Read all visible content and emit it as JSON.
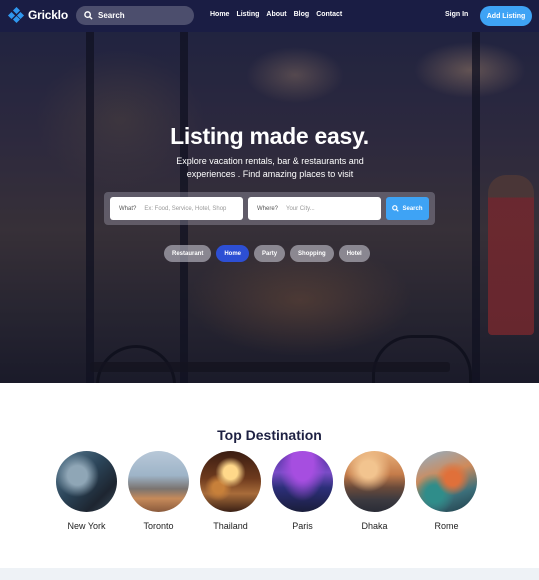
{
  "header": {
    "logo_text": "Gricklo",
    "search_label": "Search",
    "nav": [
      "Home",
      "Listing",
      "About",
      "Blog",
      "Contact"
    ],
    "sign_in": "Sign In",
    "add_listing": "Add Listing"
  },
  "hero": {
    "title": "Listing made easy.",
    "subtitle": "Explore vacation rentals, bar & restaurants and experiences . Find amazing places to visit",
    "search": {
      "what_label": "What?",
      "what_placeholder": "Ex: Food, Service, Hotel, Shop",
      "where_label": "Where?",
      "where_placeholder": "Your City...",
      "button": "Search"
    },
    "chips": [
      {
        "label": "Restaurant",
        "active": false
      },
      {
        "label": "Home",
        "active": true
      },
      {
        "label": "Party",
        "active": false
      },
      {
        "label": "Shopping",
        "active": false
      },
      {
        "label": "Hotel",
        "active": false
      }
    ]
  },
  "destinations": {
    "title": "Top Destination",
    "items": [
      {
        "name": "New York",
        "image": "new-york-photo"
      },
      {
        "name": "Toronto",
        "image": "toronto-photo"
      },
      {
        "name": "Thailand",
        "image": "thailand-photo"
      },
      {
        "name": "Paris",
        "image": "paris-photo"
      },
      {
        "name": "Dhaka",
        "image": "dhaka-photo"
      },
      {
        "name": "Rome",
        "image": "rome-photo"
      }
    ]
  },
  "colors": {
    "header_bg": "#1a1e44",
    "accent": "#3ea3f5",
    "chip_active": "#2d4fd4",
    "heading": "#1e2143"
  }
}
